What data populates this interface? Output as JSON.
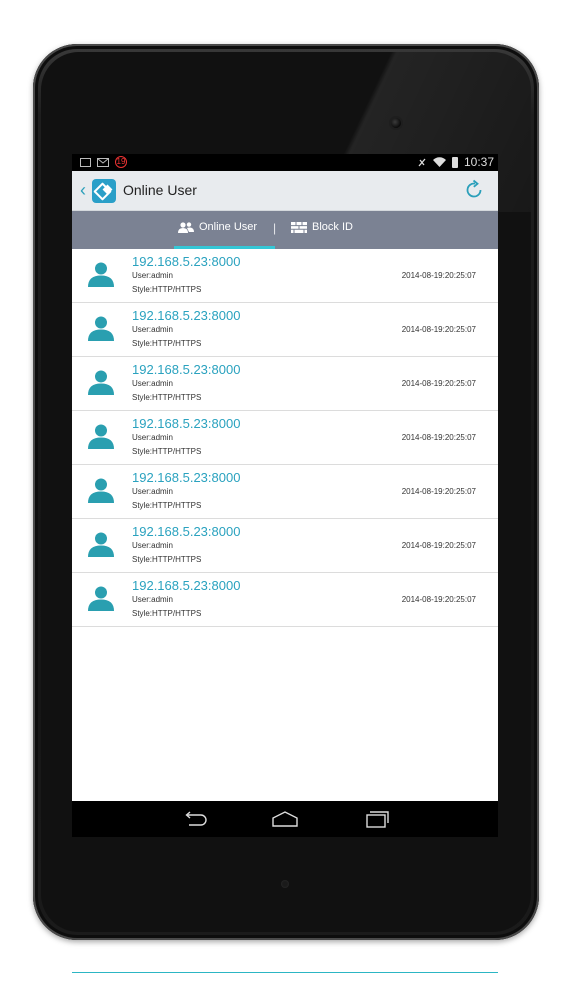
{
  "status_bar": {
    "notification_badge": "19",
    "time": "10:37",
    "icons": [
      "gallery-icon",
      "gmail-icon",
      "notification-badge-icon",
      "vibrate-icon",
      "wifi-icon",
      "battery-icon"
    ]
  },
  "action_bar": {
    "title": "Online User",
    "icons": [
      "back-chevron-icon",
      "app-logo-icon",
      "refresh-icon"
    ]
  },
  "tabs": [
    {
      "label": "Online User",
      "icon": "users-icon",
      "selected": true
    },
    {
      "label": "Block ID",
      "icon": "firewall-icon",
      "selected": false
    }
  ],
  "tab_separator": "|",
  "users": [
    {
      "address": "192.168.5.23:8000",
      "user": "User:admin",
      "style": "Style:HTTP/HTTPS",
      "time": "2014-08-19:20:25:07"
    },
    {
      "address": "192.168.5.23:8000",
      "user": "User:admin",
      "style": "Style:HTTP/HTTPS",
      "time": "2014-08-19:20:25:07"
    },
    {
      "address": "192.168.5.23:8000",
      "user": "User:admin",
      "style": "Style:HTTP/HTTPS",
      "time": "2014-08-19:20:25:07"
    },
    {
      "address": "192.168.5.23:8000",
      "user": "User:admin",
      "style": "Style:HTTP/HTTPS",
      "time": "2014-08-19:20:25:07"
    },
    {
      "address": "192.168.5.23:8000",
      "user": "User:admin",
      "style": "Style:HTTP/HTTPS",
      "time": "2014-08-19:20:25:07"
    },
    {
      "address": "192.168.5.23:8000",
      "user": "User:admin",
      "style": "Style:HTTP/HTTPS",
      "time": "2014-08-19:20:25:07"
    },
    {
      "address": "192.168.5.23:8000",
      "user": "User:admin",
      "style": "Style:HTTP/HTTPS",
      "time": "2014-08-19:20:25:07"
    }
  ],
  "nav_bar": {
    "icons": [
      "back-icon",
      "home-icon",
      "recents-icon"
    ]
  },
  "colors": {
    "accent": "#2aa2bf",
    "tab_bar": "#7b8293",
    "tab_indicator": "#35c7d6",
    "avatar": "#2a9fb0"
  }
}
